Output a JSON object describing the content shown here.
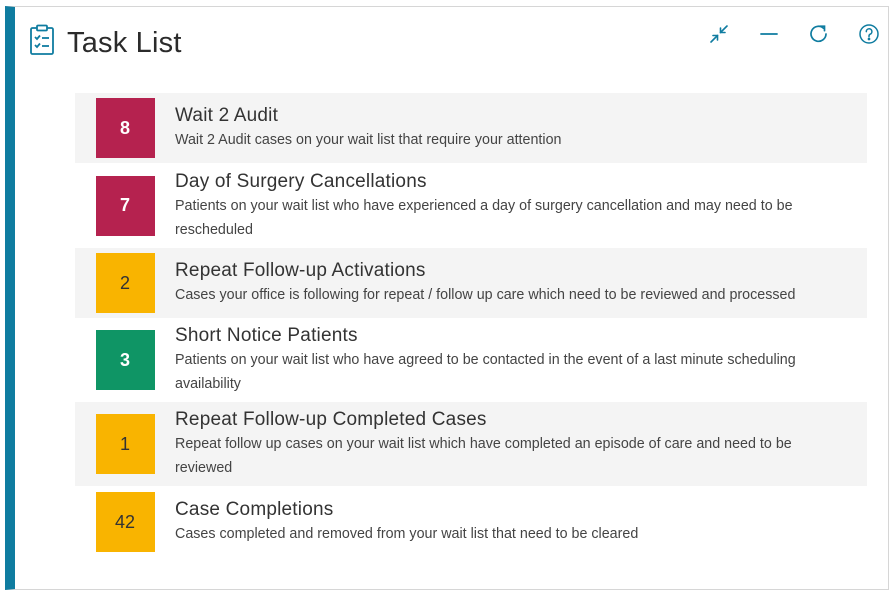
{
  "header": {
    "title": "Task List",
    "icons": [
      "clipboard-checklist-icon",
      "collapse-icon",
      "minimize-icon",
      "refresh-icon",
      "help-icon"
    ]
  },
  "colors": {
    "accent": "#0f7ca0",
    "crimson": "#b5224f",
    "amber": "#f9b400",
    "green": "#0f9565"
  },
  "tasks": [
    {
      "count": "8",
      "title": "Wait 2 Audit",
      "description": "Wait 2 Audit cases on your wait list that require your attention",
      "color": "crimson"
    },
    {
      "count": "7",
      "title": "Day of Surgery Cancellations",
      "description": "Patients on your wait list who have experienced a day of surgery cancellation and may need to be rescheduled",
      "color": "crimson"
    },
    {
      "count": "2",
      "title": "Repeat Follow-up Activations",
      "description": "Cases your office is following for repeat / follow up care which need to be reviewed and processed",
      "color": "amber"
    },
    {
      "count": "3",
      "title": "Short Notice Patients",
      "description": "Patients on your wait list who have agreed to be contacted in the event of a last minute scheduling availability",
      "color": "green"
    },
    {
      "count": "1",
      "title": "Repeat Follow-up Completed Cases",
      "description": "Repeat follow up cases on your wait list which have completed an episode of care and need to be reviewed",
      "color": "amber"
    },
    {
      "count": "42",
      "title": "Case Completions",
      "description": "Cases completed and removed from your wait list that need to be cleared",
      "color": "amber"
    }
  ]
}
